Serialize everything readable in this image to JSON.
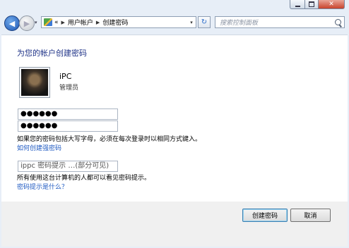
{
  "window": {
    "title": ""
  },
  "nav": {
    "breadcrumb_prefix": "«",
    "breadcrumb": [
      "用户帐户",
      "创建密码"
    ],
    "search_placeholder": "搜索控制面板"
  },
  "content": {
    "heading": "为您的帐户创建密码",
    "user": {
      "name": "iPC",
      "role": "管理员"
    },
    "password_value": "●●●●●●",
    "confirm_value": "●●●●●●",
    "hint_value": "ippc 密码提示 …(部分可见)",
    "caps_note": "如果您的密码包括大写字母，必须在每次登录时以相同方式键入。",
    "strong_pw_link": "如何创建强密码",
    "hint_note": "所有使用这台计算机的人都可以看见密码提示。",
    "hint_link": "密码提示是什么？"
  },
  "buttons": {
    "create": "创建密码",
    "cancel": "取消"
  },
  "colors": {
    "heading": "#1e3287",
    "link": "#1f5ac2",
    "window_bg": "#e7eef7"
  },
  "icons": [
    "back-arrow-icon",
    "forward-arrow-icon",
    "control-panel-icon",
    "refresh-icon",
    "search-icon"
  ]
}
